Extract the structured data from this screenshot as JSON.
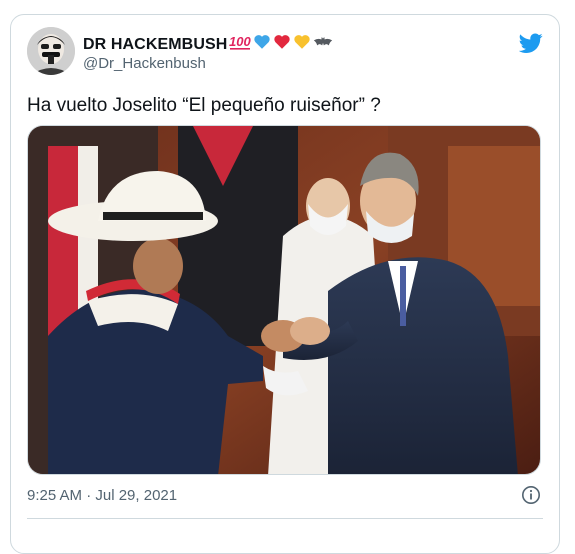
{
  "tweet": {
    "display_name": "DR HACKEMBUSH",
    "handle": "@Dr_Hackenbush",
    "text": "Ha vuelto Joselito “El pequeño ruiseñor” ?",
    "timestamp": "9:25 AM · Jul 29, 2021",
    "name_emojis": [
      "hundred-points",
      "blue-heart",
      "red-heart",
      "yellow-heart",
      "bat"
    ]
  },
  "colors": {
    "twitter_blue": "#1d9bf0",
    "border": "#cfd9de",
    "secondary_text": "#536471",
    "primary_text": "#0f1419"
  },
  "icons": {
    "logo": "twitter-bird-icon",
    "info": "info-icon"
  },
  "media": {
    "kind": "photo",
    "alt": ""
  }
}
